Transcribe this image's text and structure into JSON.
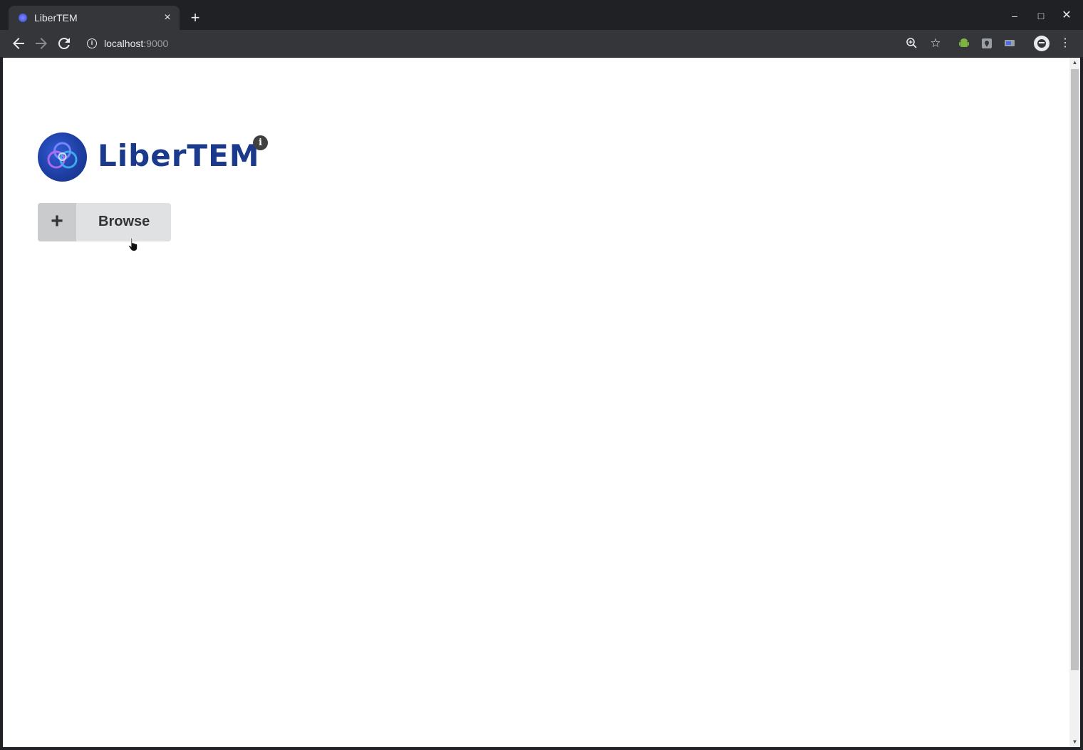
{
  "browser": {
    "tab_title": "LiberTEM",
    "tab_close": "×",
    "new_tab": "+",
    "url_host": "localhost",
    "url_port": ":9000",
    "window_controls": {
      "minimize": "–",
      "maximize": "□",
      "close": "✕"
    },
    "icons": {
      "back": "back-arrow-icon",
      "forward": "forward-arrow-icon",
      "reload": "reload-icon",
      "info": "site-info-icon",
      "zoom": "zoom-icon",
      "bookmark": "star-icon",
      "menu": "kebab-menu-icon"
    }
  },
  "app": {
    "logo_text": "LiberTEM",
    "info_glyph": "i",
    "browse_button": {
      "icon": "+",
      "label": "Browse"
    }
  },
  "colors": {
    "logo_blue": "#1b3a8c",
    "button_bg": "#e0e1e2",
    "button_icon_bg": "#cacbcd"
  }
}
